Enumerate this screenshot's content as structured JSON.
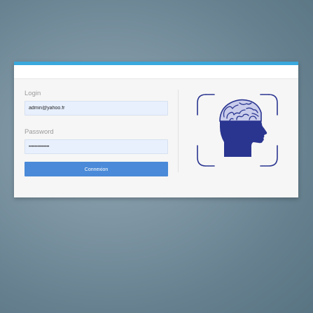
{
  "login_form": {
    "login_label": "Login",
    "login_value": "admin@yahoo.fr",
    "password_label": "Password",
    "password_value": "••••••••••••••",
    "submit_label": "Connexion"
  },
  "logo": {
    "icon": "brain-head-scan-icon"
  },
  "colors": {
    "accent_bar": "#3aa8dc",
    "button": "#4a8ad8",
    "logo_primary": "#2a3590",
    "input_bg": "#e8f0fe"
  }
}
